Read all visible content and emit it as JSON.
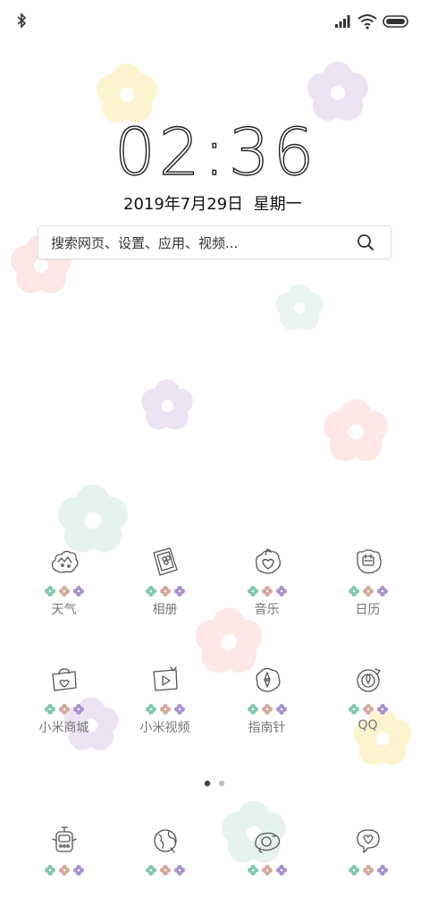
{
  "status_bar": {
    "left_icon": "bluetooth-icon",
    "right_icons": [
      "signal-icon",
      "wifi-icon",
      "battery-icon"
    ]
  },
  "clock": {
    "time": "02:36",
    "date": "2019年7月29日  星期一"
  },
  "search": {
    "placeholder": "搜索网页、设置、应用、视频..."
  },
  "colors": {
    "dot_green": "#7fc8ad",
    "dot_pink": "#d6a89a",
    "dot_purple": "#a98fd0"
  },
  "apps": [
    {
      "label": "天气",
      "icon": "weather-icon"
    },
    {
      "label": "相册",
      "icon": "gallery-icon"
    },
    {
      "label": "音乐",
      "icon": "music-icon"
    },
    {
      "label": "日历",
      "icon": "calendar-icon"
    },
    {
      "label": "小米商城",
      "icon": "mi-store-icon"
    },
    {
      "label": "小米视频",
      "icon": "mi-video-icon"
    },
    {
      "label": "指南针",
      "icon": "compass-icon"
    },
    {
      "label": "QQ",
      "icon": "qq-icon"
    }
  ],
  "dock": [
    {
      "icon": "phone-icon"
    },
    {
      "icon": "browser-icon"
    },
    {
      "icon": "camera-icon"
    },
    {
      "icon": "messages-icon"
    }
  ],
  "pager": {
    "pages": 2,
    "current": 1
  }
}
